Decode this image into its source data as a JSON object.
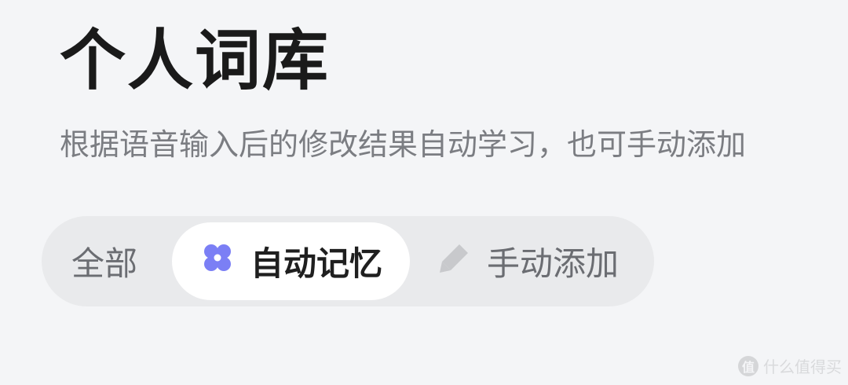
{
  "header": {
    "title": "个人词库",
    "subtitle": "根据语音输入后的修改结果自动学习，也可手动添加"
  },
  "tabs": [
    {
      "label": "全部",
      "selected": false
    },
    {
      "label": "自动记忆",
      "selected": true,
      "icon": "clover-icon",
      "icon_color": "#7b7ff5"
    },
    {
      "label": "手动添加",
      "selected": false,
      "icon": "pencil-icon",
      "icon_color": "#c8c9cc"
    }
  ],
  "watermark": {
    "icon_text": "值",
    "text": "什么值得买"
  },
  "colors": {
    "background": "#f4f5f7",
    "tab_group_bg": "#e9eaec",
    "selected_tab_bg": "#ffffff",
    "accent": "#7b7ff5"
  }
}
